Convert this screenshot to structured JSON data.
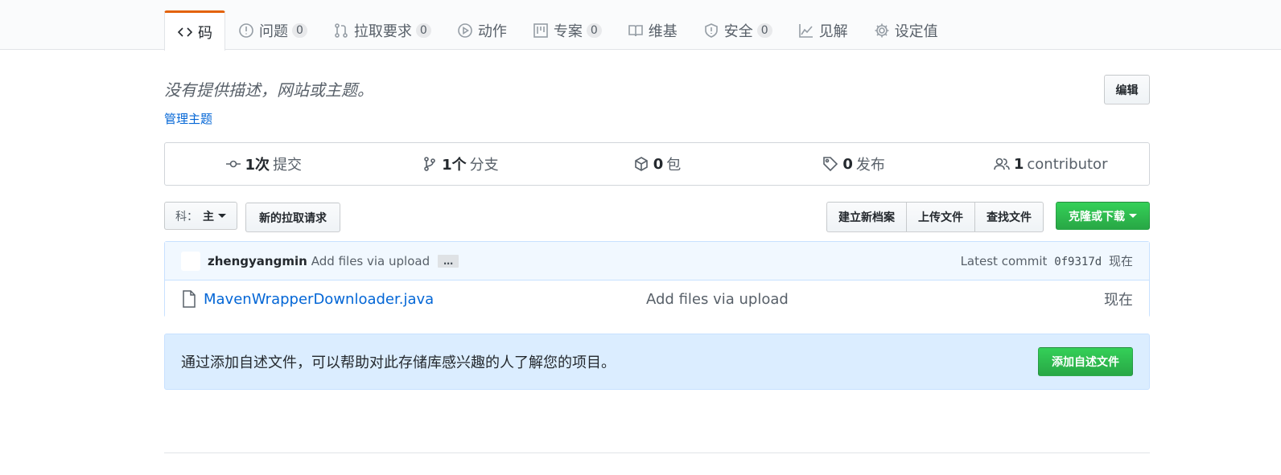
{
  "nav": {
    "tabs": [
      {
        "label": "码",
        "icon": "code-icon"
      },
      {
        "label": "问题",
        "count": "0",
        "icon": "issue-icon"
      },
      {
        "label": "拉取要求",
        "count": "0",
        "icon": "pull-request-icon"
      },
      {
        "label": "动作",
        "icon": "play-icon"
      },
      {
        "label": "专案",
        "count": "0",
        "icon": "project-icon"
      },
      {
        "label": "维基",
        "icon": "book-icon"
      },
      {
        "label": "安全",
        "count": "0",
        "icon": "shield-icon"
      },
      {
        "label": "见解",
        "icon": "graph-icon"
      },
      {
        "label": "设定值",
        "icon": "gear-icon"
      }
    ],
    "selected": "码",
    "accent": "#e36209"
  },
  "repo": {
    "description": "没有提供描述，网站或主题。",
    "manage_topics": "管理主题",
    "edit_label": "编辑"
  },
  "summary": {
    "commits": {
      "num": "1次",
      "label": "提交"
    },
    "branches": {
      "num": "1个",
      "label": "分支"
    },
    "packages": {
      "num": "0",
      "label": "包"
    },
    "releases": {
      "num": "0",
      "label": "发布"
    },
    "contributors": {
      "num": "1",
      "label": "contributor"
    }
  },
  "toolbar": {
    "branch_label": "科：",
    "branch_value": "主",
    "new_pr": "新的拉取请求",
    "create_file": "建立新档案",
    "upload_files": "上传文件",
    "find_file": "查找文件",
    "clone": "克隆或下载",
    "clone_color": "#28a745"
  },
  "commit": {
    "author": "zhengyangmin",
    "message": "Add files via upload",
    "ellipsis": "…",
    "latest_label": "Latest commit",
    "sha": "0f9317d",
    "age": "现在"
  },
  "files": [
    {
      "name": "MavenWrapperDownloader.java",
      "message": "Add files via upload",
      "age": "现在",
      "icon": "file-icon"
    }
  ],
  "readme_prompt": {
    "text": "通过添加自述文件，可以帮助对此存储库感兴趣的人了解您的项目。",
    "button": "添加自述文件"
  }
}
